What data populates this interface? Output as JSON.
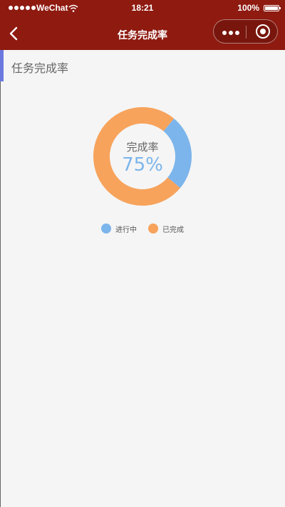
{
  "status_bar": {
    "carrier": "WeChat",
    "time": "18:21",
    "battery": "100%"
  },
  "nav": {
    "title": "任务完成率"
  },
  "section": {
    "title": "任务完成率"
  },
  "chart_data": {
    "type": "pie",
    "title": "",
    "center_label": "完成率",
    "center_value": "75%",
    "series": [
      {
        "name": "进行中",
        "value": 25,
        "color": "#7cb5ec"
      },
      {
        "name": "已完成",
        "value": 75,
        "color": "#f7a35c"
      }
    ],
    "legend_position": "bottom"
  }
}
